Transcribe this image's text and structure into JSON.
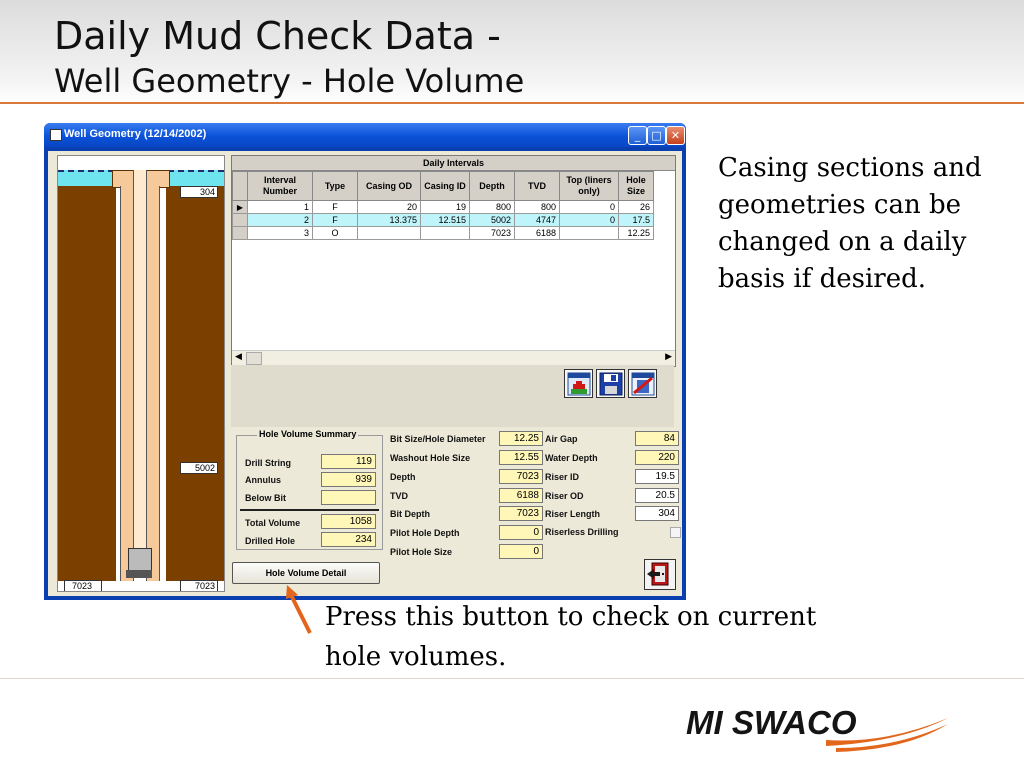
{
  "slide": {
    "title_line1": "Daily Mud Check Data -",
    "title_line2": "Well Geometry - Hole Volume",
    "note_right": "Casing sections and geometries can be changed on a daily basis if desired.",
    "note_bottom": "Press this button to check on current hole volumes.",
    "logo_text": "MI SWACO",
    "accent_color": "#d9793c"
  },
  "window": {
    "title": "Well Geometry (12/14/2002)",
    "controls": {
      "minimize": "_",
      "maximize": "□",
      "close": "✕"
    }
  },
  "well_drawing": {
    "marker_top": "304",
    "marker_mid": "5002",
    "marker_bottom_left": "7023",
    "marker_bottom_right": "7023"
  },
  "grid": {
    "caption": "Daily Intervals",
    "columns": [
      "Interval Number",
      "Type",
      "Casing OD",
      "Casing ID",
      "Depth",
      "TVD",
      "Top (liners only)",
      "Hole Size"
    ],
    "rows": [
      {
        "marker": "▶",
        "interval": "1",
        "type": "F",
        "casing_od": "20",
        "casing_id": "19",
        "depth": "800",
        "tvd": "800",
        "top": "0",
        "hole_size": "26"
      },
      {
        "marker": "",
        "interval": "2",
        "type": "F",
        "casing_od": "13.375",
        "casing_id": "12.515",
        "depth": "5002",
        "tvd": "4747",
        "top": "0",
        "hole_size": "17.5"
      },
      {
        "marker": "",
        "interval": "3",
        "type": "O",
        "casing_od": "",
        "casing_id": "",
        "depth": "7023",
        "tvd": "6188",
        "top": "",
        "hole_size": "12.25"
      }
    ],
    "buttons": [
      "add-new-icon",
      "save-icon",
      "delete-icon"
    ]
  },
  "summary": {
    "title": "Hole Volume Summary",
    "drill_string_label": "Drill String",
    "drill_string": "119",
    "annulus_label": "Annulus",
    "annulus": "939",
    "below_bit_label": "Below Bit",
    "below_bit": "",
    "total_volume_label": "Total Volume",
    "total_volume": "1058",
    "drilled_hole_label": "Drilled Hole",
    "drilled_hole": "234"
  },
  "hole_volume_detail_button": "Hole Volume Detail",
  "fields_mid": {
    "bit_size_label": "Bit Size/Hole Diameter",
    "bit_size": "12.25",
    "washout_label": "Washout Hole Size",
    "washout": "12.55",
    "depth_label": "Depth",
    "depth": "7023",
    "tvd_label": "TVD",
    "tvd": "6188",
    "bit_depth_label": "Bit Depth",
    "bit_depth": "7023",
    "pilot_depth_label": "Pilot Hole Depth",
    "pilot_depth": "0",
    "pilot_size_label": "Pilot Hole Size",
    "pilot_size": "0"
  },
  "fields_right": {
    "air_gap_label": "Air Gap",
    "air_gap": "84",
    "water_depth_label": "Water Depth",
    "water_depth": "220",
    "riser_id_label": "Riser ID",
    "riser_id": "19.5",
    "riser_od_label": "Riser OD",
    "riser_od": "20.5",
    "riser_length_label": "Riser Length",
    "riser_length": "304",
    "riserless_label": "Riserless Drilling"
  }
}
